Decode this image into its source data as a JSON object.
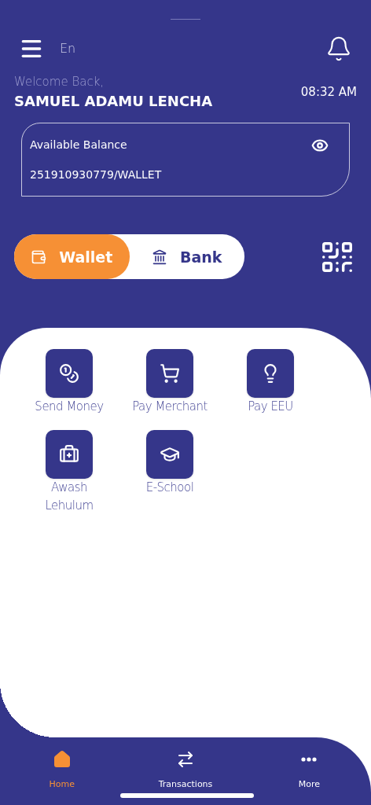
{
  "header": {
    "language": "En",
    "greeting": "Welcome Back,",
    "user_name": "SAMUEL ADAMU LENCHA",
    "time": "08:32 AM"
  },
  "balance_card": {
    "label": "Available Balance",
    "account": "251910930779/WALLET"
  },
  "account_tabs": [
    {
      "label": "Wallet",
      "kind": "wallet",
      "selected": true
    },
    {
      "label": "Bank",
      "kind": "bank",
      "selected": false
    }
  ],
  "services": [
    {
      "label": "Send Money",
      "kind": "send"
    },
    {
      "label": "Pay Merchant",
      "kind": "merchant"
    },
    {
      "label": "Pay EEU",
      "kind": "electricity"
    },
    {
      "label": "Awash Lehulum",
      "kind": "health"
    },
    {
      "label": "E-School",
      "kind": "school"
    }
  ],
  "bottom_nav": [
    {
      "label": "Home",
      "kind": "home",
      "selected": true
    },
    {
      "label": "Transactions",
      "kind": "transactions",
      "selected": false
    },
    {
      "label": "More",
      "kind": "more",
      "selected": false
    }
  ]
}
